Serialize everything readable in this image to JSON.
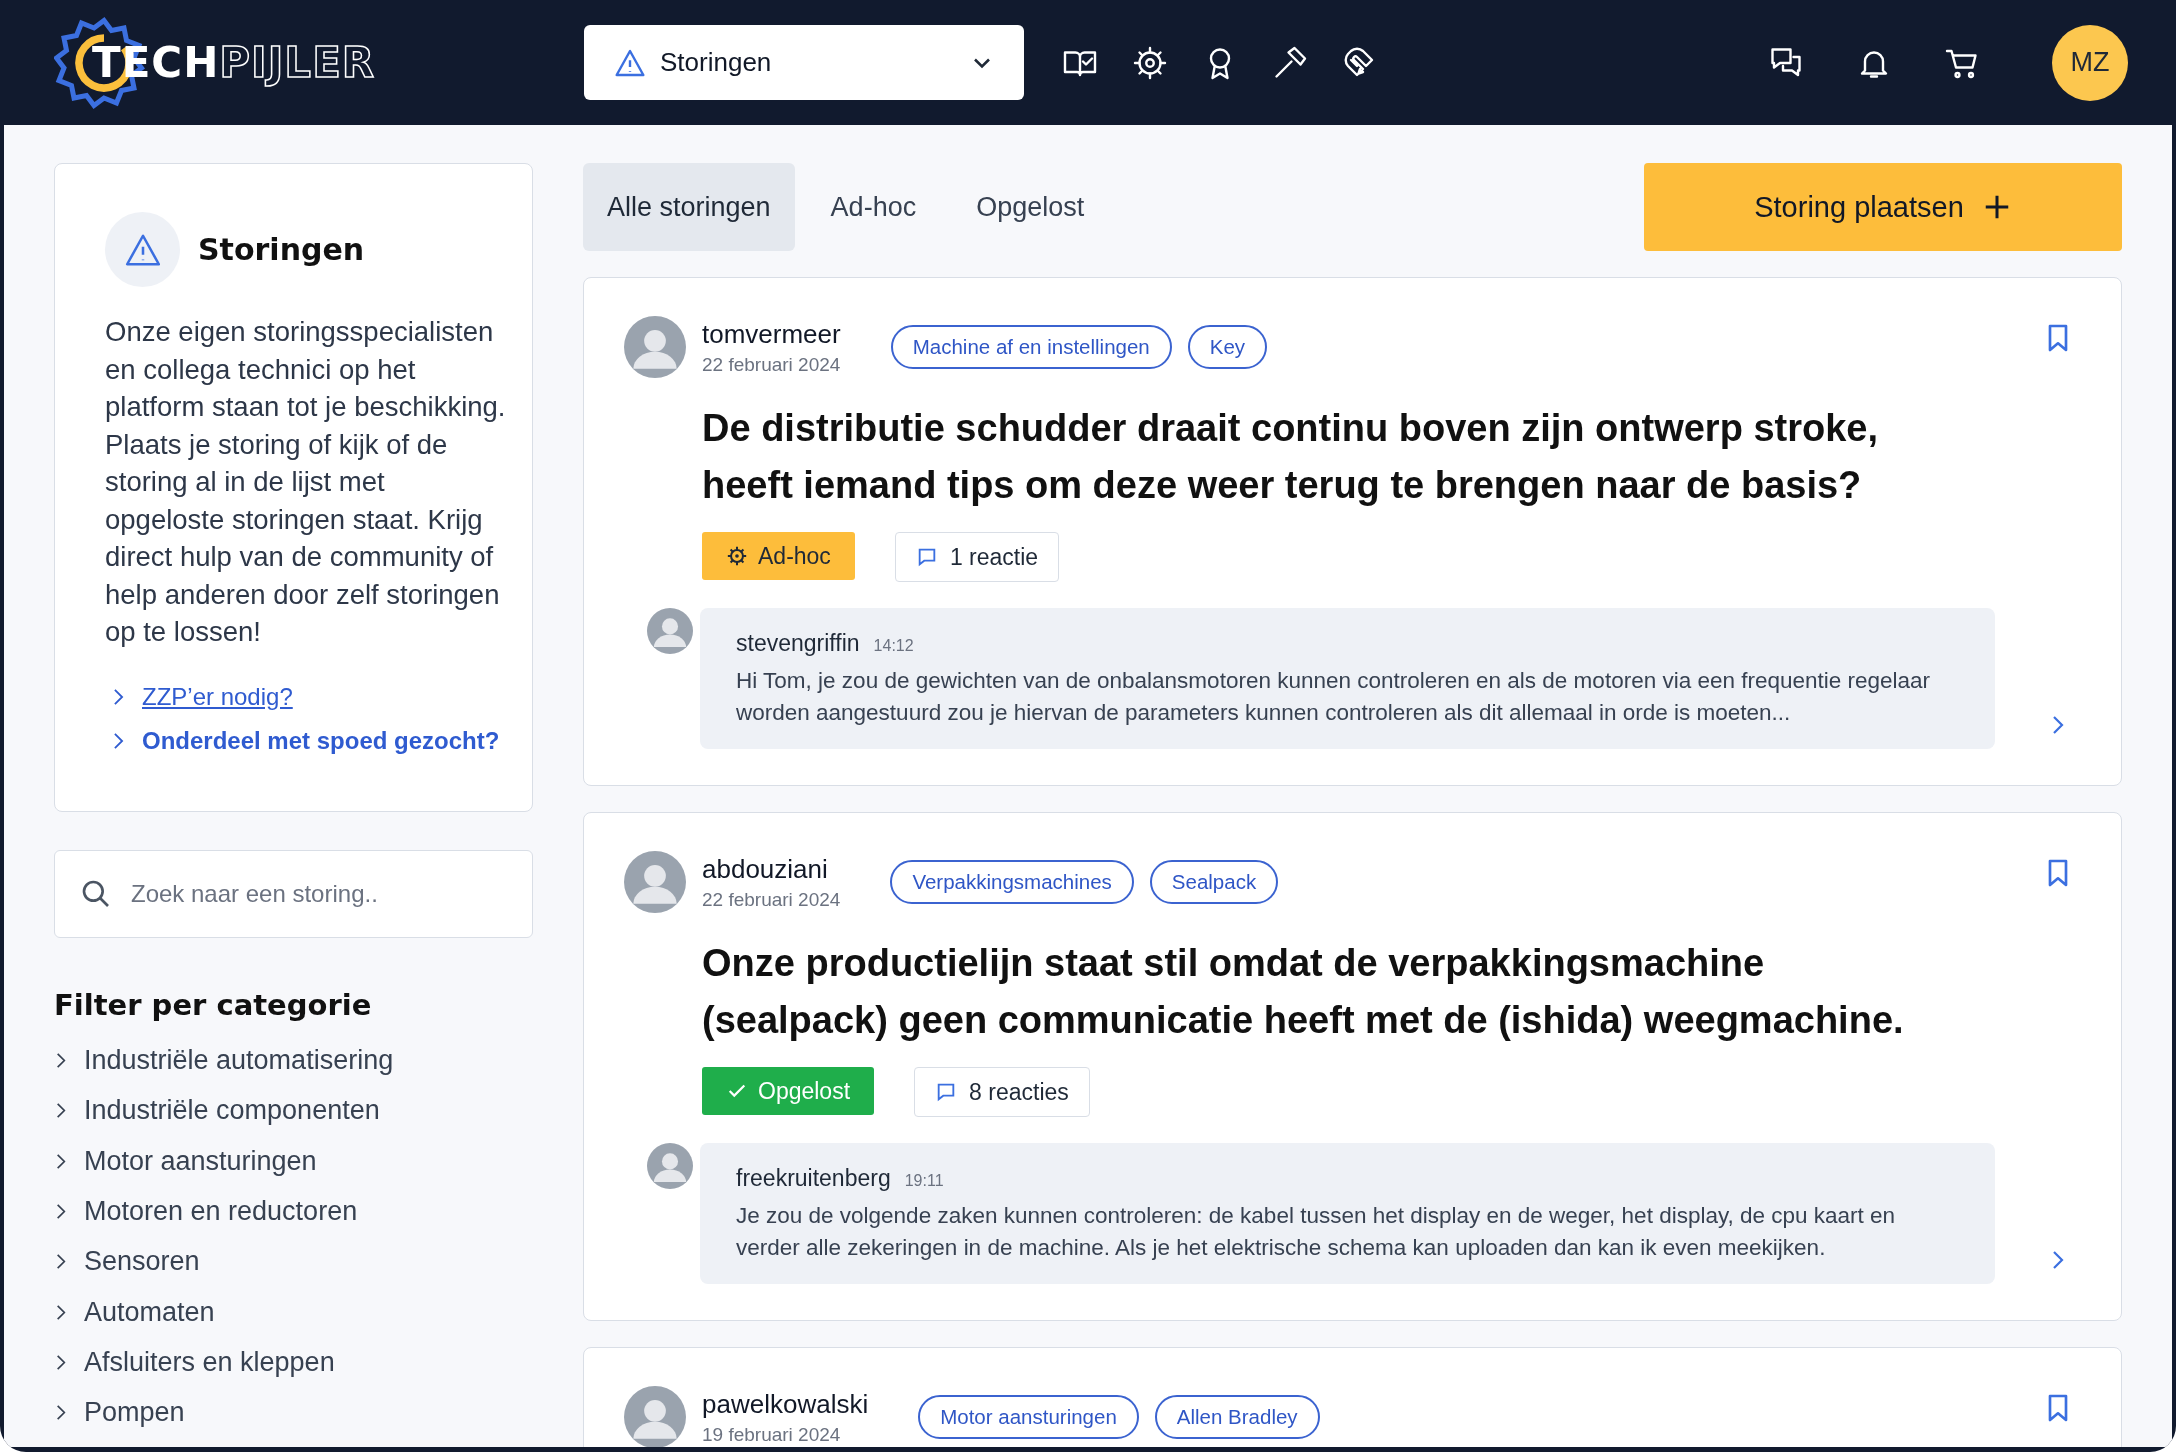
{
  "header": {
    "logo": {
      "strong": "TECH",
      "outline": "PIJLER"
    },
    "section_select": {
      "value": "Storingen"
    },
    "avatar": "MZ"
  },
  "sidebar": {
    "intro": {
      "title": "Storingen",
      "text": "Onze eigen storingsspecialisten en collega technici op het platform staan tot je beschikking. Plaats je storing of kijk of de storing al in de lijst met opgeloste storingen staat. Krijg direct hulp van de community of help anderen door zelf storingen op te lossen!",
      "links": [
        {
          "label": "ZZP’er nodig?",
          "hovered": true
        },
        {
          "label": "Onderdeel met spoed gezocht?",
          "hovered": false
        }
      ]
    },
    "search": {
      "placeholder": "Zoek naar een storing.."
    },
    "filter": {
      "title": "Filter per categorie",
      "categories": [
        "Industriële automatisering",
        "Industriële componenten",
        "Motor aansturingen",
        "Motoren en reductoren",
        "Sensoren",
        "Automaten",
        "Afsluiters en kleppen",
        "Pompen"
      ]
    }
  },
  "tabs": [
    {
      "label": "Alle storingen",
      "selected": true
    },
    {
      "label": "Ad-hoc",
      "selected": false
    },
    {
      "label": "Opgelost",
      "selected": false
    }
  ],
  "new_button": "Storing plaatsen",
  "posts": [
    {
      "author": "tomvermeer",
      "date": "22 februari 2024",
      "tags": [
        "Machine af en instellingen",
        "Key"
      ],
      "title": "De distributie schudder draait continu boven zijn ontwerp stroke, heeft iemand tips om deze weer terug te brengen naar de basis?",
      "status": {
        "kind": "adhoc",
        "label": "Ad-hoc"
      },
      "reactions": "1 reactie",
      "reply": {
        "author": "stevengriffin",
        "time": "14:12",
        "text": "Hi Tom, je zou de gewichten van de onbalansmotoren kunnen controleren en als de motoren via een frequentie regelaar worden aangestuurd zou je hiervan de parameters kunnen controleren als dit allemaal in orde is moeten..."
      }
    },
    {
      "author": "abdouziani",
      "date": "22 februari 2024",
      "tags": [
        "Verpakkingsmachines",
        "Sealpack"
      ],
      "title": "Onze productielijn staat stil omdat de verpakkingsmachine (sealpack) geen communicatie heeft met de (ishida) weegmachine.",
      "status": {
        "kind": "solved",
        "label": "Opgelost"
      },
      "reactions": "8 reacties",
      "reply": {
        "author": "freekruitenberg",
        "time": "19:11",
        "text": "Je zou de volgende zaken kunnen controleren: de kabel tussen het display en de weger, het display, de cpu kaart en verder alle zekeringen in de machine. Als je het elektrische schema kan uploaden dan kan ik even meekijken."
      }
    },
    {
      "author": "pawelkowalski",
      "date": "19 februari 2024",
      "tags": [
        "Motor aansturingen",
        "Allen Bradley"
      ]
    }
  ]
}
